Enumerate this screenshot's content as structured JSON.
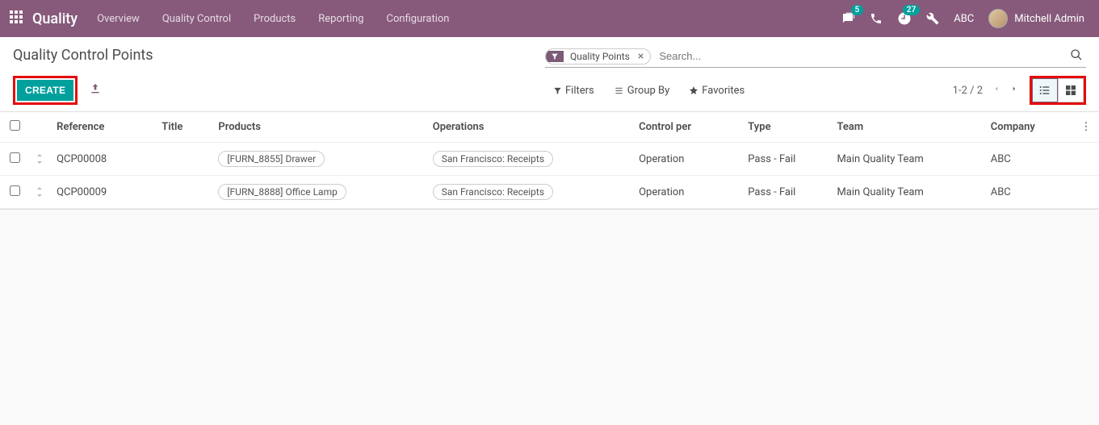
{
  "nav": {
    "brand": "Quality",
    "menu": [
      "Overview",
      "Quality Control",
      "Products",
      "Reporting",
      "Configuration"
    ],
    "chat_badge": "5",
    "activity_badge": "27",
    "company": "ABC",
    "user": "Mitchell Admin"
  },
  "breadcrumb": "Quality Control Points",
  "search": {
    "facet_label": "Quality Points",
    "placeholder": "Search..."
  },
  "buttons": {
    "create": "CREATE"
  },
  "search_opts": {
    "filters": "Filters",
    "groupby": "Group By",
    "favorites": "Favorites"
  },
  "pager": {
    "range": "1-2 / 2"
  },
  "columns": {
    "reference": "Reference",
    "title": "Title",
    "products": "Products",
    "operations": "Operations",
    "control_per": "Control per",
    "type": "Type",
    "team": "Team",
    "company": "Company"
  },
  "rows": [
    {
      "reference": "QCP00008",
      "title": "",
      "product": "[FURN_8855] Drawer",
      "operation": "San Francisco: Receipts",
      "control_per": "Operation",
      "type": "Pass - Fail",
      "team": "Main Quality Team",
      "company": "ABC"
    },
    {
      "reference": "QCP00009",
      "title": "",
      "product": "[FURN_8888] Office Lamp",
      "operation": "San Francisco: Receipts",
      "control_per": "Operation",
      "type": "Pass - Fail",
      "team": "Main Quality Team",
      "company": "ABC"
    }
  ]
}
